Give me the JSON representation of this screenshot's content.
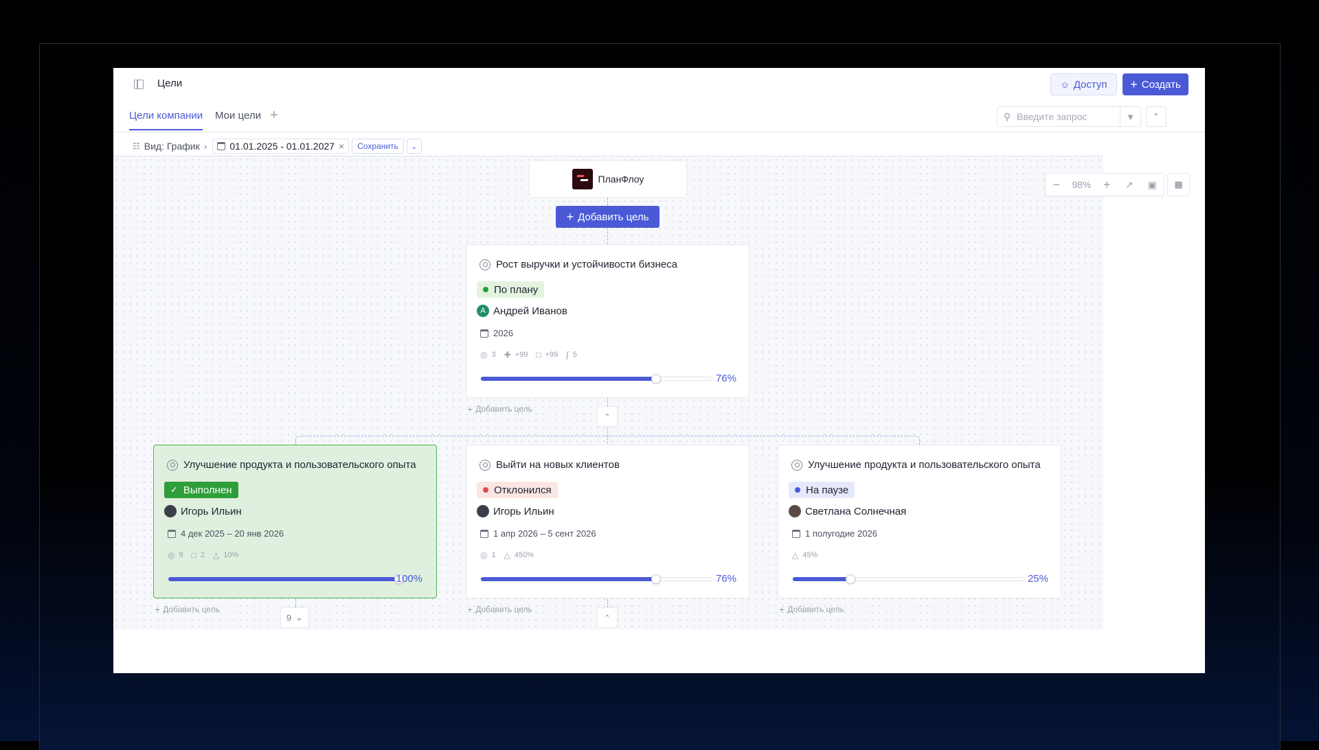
{
  "header": {
    "title": "Цели",
    "access_label": "Доступ",
    "create_label": "Создать"
  },
  "tabs": [
    {
      "label": "Цели компании",
      "active": true
    },
    {
      "label": "Мои цели",
      "active": false
    }
  ],
  "search": {
    "placeholder": "Введите запрос"
  },
  "toolbar": {
    "view_label": "Вид: График",
    "date_range": "01.01.2025 - 01.01.2027",
    "save_label": "Сохранить"
  },
  "zoom": {
    "level": "98%"
  },
  "colors": {
    "accent": "#4a5ad6",
    "done_bg": "#dff0de",
    "done_border": "#4caf50",
    "status_on_track": "#21a336",
    "status_off_track": "#e5484d",
    "status_paused": "#4a5ad6"
  },
  "graph": {
    "root_label": "ПланФлоу",
    "add_goal_label": "Добавить цель",
    "add_child_label": "Добавить цель",
    "collapsed_count": "9",
    "top_goal": {
      "title": "Рост выручки и устойчивости бизнеса",
      "status": "По плану",
      "owner": "Андрей Иванов",
      "owner_initial": "А",
      "period": "2026",
      "stats": {
        "goals": "3",
        "tasks": "+99",
        "comments": "+99",
        "attachments": "5"
      },
      "progress": 76,
      "progress_label": "76%"
    },
    "children": [
      {
        "title": "Улучшение продукта и пользовательского опыта",
        "status": "Выполнен",
        "owner": "Игорь Ильин",
        "period": "4 дек 2025 – 20 янв 2026",
        "stats": {
          "goals": "9",
          "comments": "2",
          "weight": "10%"
        },
        "progress": 100,
        "progress_label": "100%"
      },
      {
        "title": "Выйти на новых клиентов",
        "status": "Отклонился",
        "owner": "Игорь Ильин",
        "period": "1 апр 2026 – 5 сент 2026",
        "stats": {
          "goals": "1",
          "weight": "450%"
        },
        "progress": 76,
        "progress_label": "76%"
      },
      {
        "title": "Улучшение продукта и пользовательского опыта",
        "status": "На паузе",
        "owner": "Светлана Солнечная",
        "period": "1 полугодие 2026",
        "stats": {
          "weight": "45%"
        },
        "progress": 25,
        "progress_label": "25%"
      }
    ]
  }
}
